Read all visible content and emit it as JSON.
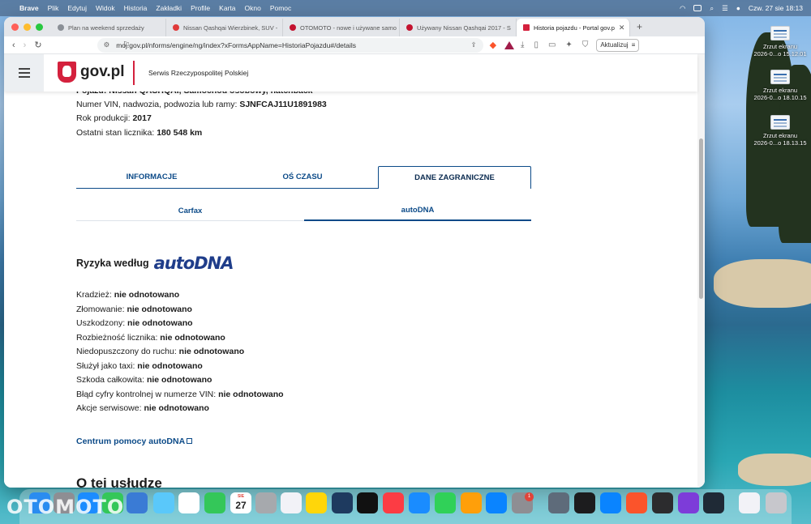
{
  "menubar": {
    "app": "Brave",
    "items": [
      "Plik",
      "Edytuj",
      "Widok",
      "Historia",
      "Zakładki",
      "Profile",
      "Karta",
      "Okno",
      "Pomoc"
    ],
    "clock": "Czw. 27 sie  18:13"
  },
  "desktop": {
    "icons": [
      {
        "line1": "Zrzut ekranu",
        "line2": "2026-0...o 15.12.01"
      },
      {
        "line1": "Zrzut ekranu",
        "line2": "2026-0...o 18.10.15"
      },
      {
        "line1": "Zrzut ekranu",
        "line2": "2026-0...o 18.13.15"
      }
    ]
  },
  "browser": {
    "tabs": [
      {
        "title": "Plan na weekend sprzedaży",
        "favicon_color": "#8a8f96"
      },
      {
        "title": "Nissan Qashqai Wierzbinek, SUV -",
        "favicon_color": "#e03a3a"
      },
      {
        "title": "OTOMOTO - nowe i używane samo",
        "favicon_color": "#c4122f"
      },
      {
        "title": "Używany Nissan Qashqai 2017 - S",
        "favicon_color": "#c4122f"
      },
      {
        "title": "Historia pojazdu - Portal gov.p",
        "favicon_color": "#d4213d"
      }
    ],
    "url": "moj.gov.pl/nforms/engine/ng/index?xFormsAppName=HistoriaPojazdu#/details",
    "update_label": "Aktualizuj"
  },
  "site": {
    "logo": "gov.pl",
    "service": "Serwis Rzeczypospolitej Polskiej"
  },
  "vehicle": {
    "cut_line": "Pojazd: Nissan QASHQAI, Samochód osobowy, hatchback",
    "vin_label": "Numer VIN, nadwozia, podwozia lub ramy: ",
    "vin": "SJNFCAJ11U1891983",
    "year_label": "Rok produkcji: ",
    "year": "2017",
    "odometer_label": "Ostatni stan licznika: ",
    "odometer": "180 548 km"
  },
  "main_tabs": [
    "INFORMACJE",
    "OŚ CZASU",
    "DANE ZAGRANICZNE"
  ],
  "sub_tabs": [
    "Carfax",
    "autoDNA"
  ],
  "risk": {
    "title": "Ryzyka według",
    "brand": "autoDNA",
    "items": [
      {
        "label": "Kradzież: ",
        "value": "nie odnotowano"
      },
      {
        "label": "Złomowanie: ",
        "value": "nie odnotowano"
      },
      {
        "label": "Uszkodzony: ",
        "value": "nie odnotowano"
      },
      {
        "label": "Rozbieżność licznika: ",
        "value": "nie odnotowano"
      },
      {
        "label": "Niedopuszczony do ruchu: ",
        "value": "nie odnotowano"
      },
      {
        "label": "Służył jako taxi: ",
        "value": "nie odnotowano"
      },
      {
        "label": "Szkoda całkowita: ",
        "value": "nie odnotowano"
      },
      {
        "label": "Błąd cyfry kontrolnej w numerze VIN: ",
        "value": "nie odnotowano"
      },
      {
        "label": "Akcje serwisowe: ",
        "value": "nie odnotowano"
      }
    ],
    "help_link": "Centrum pomocy autoDNA"
  },
  "about_heading": "O tej usłudze",
  "dock": {
    "calendar_month": "SIE",
    "calendar_day": "27",
    "settings_badge": "1"
  },
  "watermark": "OTOMOTO"
}
